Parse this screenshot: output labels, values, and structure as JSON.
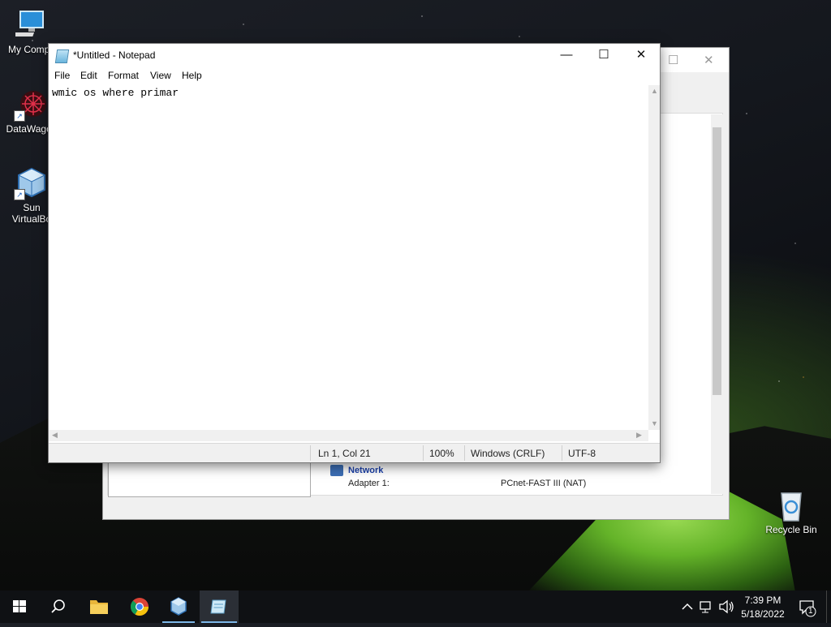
{
  "desktop": {
    "icons": [
      {
        "label": "My Compu"
      },
      {
        "label": "DataWagon"
      },
      {
        "label": "Sun VirtualBo"
      },
      {
        "label": "Recycle Bin"
      }
    ]
  },
  "background_window": {
    "network_title": "Network",
    "adapter_label": "Adapter 1:",
    "adapter_value": "PCnet-FAST III (NAT)"
  },
  "notepad": {
    "title": "*Untitled - Notepad",
    "controls": {
      "minimize": "—",
      "maximize": "☐",
      "close": "✕"
    },
    "menu": [
      "File",
      "Edit",
      "Format",
      "View",
      "Help"
    ],
    "content": "wmic os where primar",
    "status": {
      "position": "Ln 1, Col 21",
      "zoom": "100%",
      "line_ending": "Windows (CRLF)",
      "encoding": "UTF-8"
    }
  },
  "taskbar": {
    "time": "7:39 PM",
    "date": "5/18/2022",
    "notification_count": "1"
  },
  "colors": {
    "taskbar": "#0f1114",
    "accent": "#7db7e8"
  }
}
